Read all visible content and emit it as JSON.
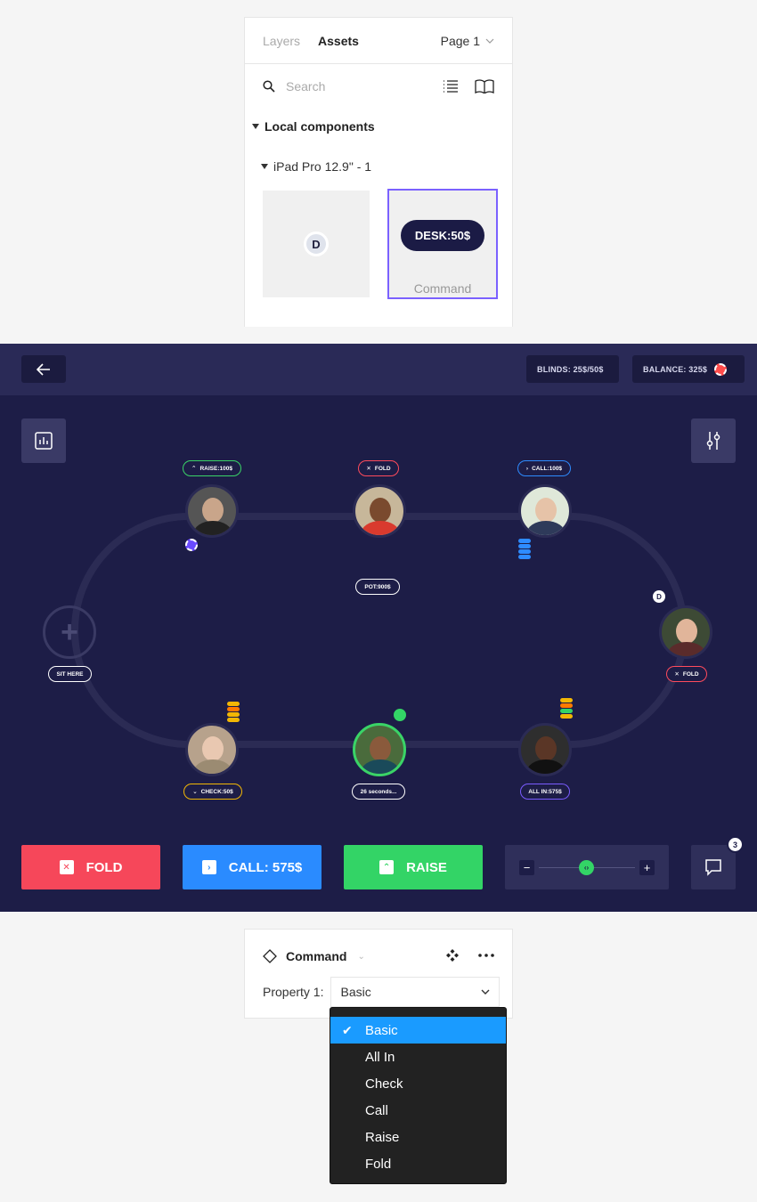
{
  "assets_panel": {
    "tabs": [
      "Layers",
      "Assets"
    ],
    "page": "Page 1",
    "search_placeholder": "Search",
    "section": "Local components",
    "subsection": "iPad Pro 12.9\" - 1",
    "thumb1_badge": "D",
    "thumb2_pill": "DESK:50$",
    "thumb2_caption": "Command"
  },
  "game": {
    "blinds": "BLINDS: 25$/50$",
    "balance": "BALANCE: 325$",
    "pot": "POT:900$",
    "sit_here": "SIT HERE",
    "dealer": "D",
    "tags": {
      "raise": "RAISE:100$",
      "fold_top": "FOLD",
      "call": "CALL:100$",
      "fold_right": "FOLD",
      "check": "CHECK:50$",
      "timer": "26 seconds...",
      "allin": "ALL IN:575$"
    },
    "actions": {
      "fold": "FOLD",
      "call": "CALL: 575$",
      "raise": "RAISE"
    },
    "chat_count": "3",
    "colors": {
      "background": "#1d1d47",
      "fold": "#f6475a",
      "call": "#2a8bff",
      "raise": "#33d466"
    }
  },
  "command_panel": {
    "title": "Command",
    "property_label": "Property 1:",
    "property_value": "Basic"
  },
  "dropdown": {
    "options": [
      "Basic",
      "All In",
      "Check",
      "Call",
      "Raise",
      "Fold"
    ],
    "selected": "Basic"
  }
}
